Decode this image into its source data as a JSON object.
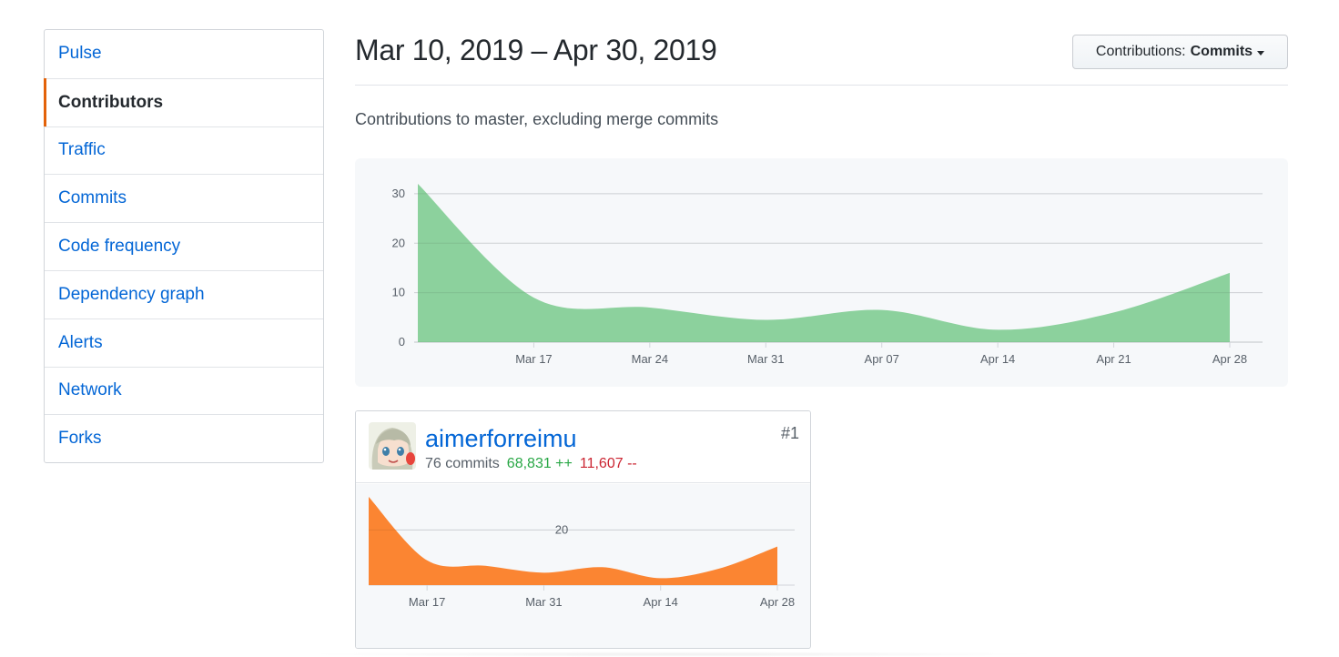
{
  "sidebar": {
    "items": [
      {
        "label": "Pulse",
        "selected": false
      },
      {
        "label": "Contributors",
        "selected": true
      },
      {
        "label": "Traffic",
        "selected": false
      },
      {
        "label": "Commits",
        "selected": false
      },
      {
        "label": "Code frequency",
        "selected": false
      },
      {
        "label": "Dependency graph",
        "selected": false
      },
      {
        "label": "Alerts",
        "selected": false
      },
      {
        "label": "Network",
        "selected": false
      },
      {
        "label": "Forks",
        "selected": false
      }
    ],
    "accent_color": "#e36209"
  },
  "header": {
    "date_range": "Mar 10, 2019 – Apr 30, 2019",
    "select_prefix": "Contributions:",
    "select_value": "Commits",
    "subtitle": "Contributions to master, excluding merge commits"
  },
  "chart_data": [
    {
      "type": "area",
      "color": "#8cd19d",
      "ylim": [
        0,
        32
      ],
      "yticks": [
        "0",
        "10",
        "20",
        "30"
      ],
      "x": [
        "Mar 10",
        "Mar 17",
        "Mar 24",
        "Mar 31",
        "Apr 07",
        "Apr 14",
        "Apr 21",
        "Apr 28"
      ],
      "values": [
        32,
        9,
        7,
        4.5,
        6.5,
        2.5,
        6,
        14
      ],
      "tick_labels": [
        "Mar 17",
        "Mar 24",
        "Mar 31",
        "Apr 07",
        "Apr 14",
        "Apr 21",
        "Apr 28"
      ],
      "grid": true
    },
    {
      "type": "area",
      "color": "#fb8532",
      "ylim": [
        0,
        32
      ],
      "yticks": [
        "20"
      ],
      "x": [
        "Mar 10",
        "Mar 17",
        "Mar 24",
        "Mar 31",
        "Apr 07",
        "Apr 14",
        "Apr 21",
        "Apr 28"
      ],
      "values": [
        32,
        9,
        7,
        4.5,
        6.5,
        2.5,
        6,
        14
      ],
      "tick_labels": [
        "Mar 17",
        "Mar 31",
        "Apr 14",
        "Apr 28"
      ],
      "grid": true
    }
  ],
  "contributor": {
    "username": "aimerforreimu",
    "commits": "76 commits",
    "additions": "68,831 ++",
    "deletions": "11,607 --",
    "rank": "#1"
  }
}
